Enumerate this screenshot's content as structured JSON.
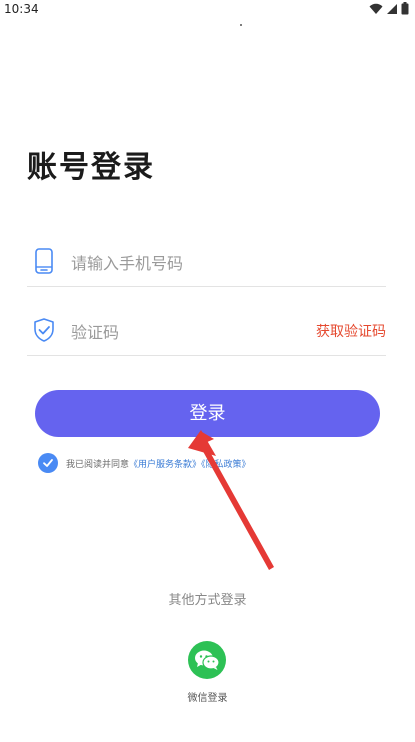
{
  "status_bar": {
    "time": "10:34"
  },
  "title": "账号登录",
  "phone_field": {
    "placeholder": "请输入手机号码",
    "value": "",
    "icon": "phone-icon"
  },
  "code_field": {
    "placeholder": "验证码",
    "value": "",
    "icon": "shield-check-icon",
    "get_code_label": "获取验证码"
  },
  "login_button": {
    "label": "登录"
  },
  "agreement": {
    "checked": true,
    "text": "我已阅读并同意",
    "user_terms": "《用户服务条款》",
    "separator": "",
    "privacy_policy": "《隐私政策》"
  },
  "other_login": {
    "title": "其他方式登录",
    "wechat_label": "微信登录",
    "wechat_icon": "wechat-icon"
  },
  "colors": {
    "primary": "#6563ef",
    "link": "#3a7bd5",
    "get_code": "#e5492f",
    "check": "#4a8af4",
    "wechat": "#2dc155",
    "annotation_arrow": "#e53935"
  }
}
